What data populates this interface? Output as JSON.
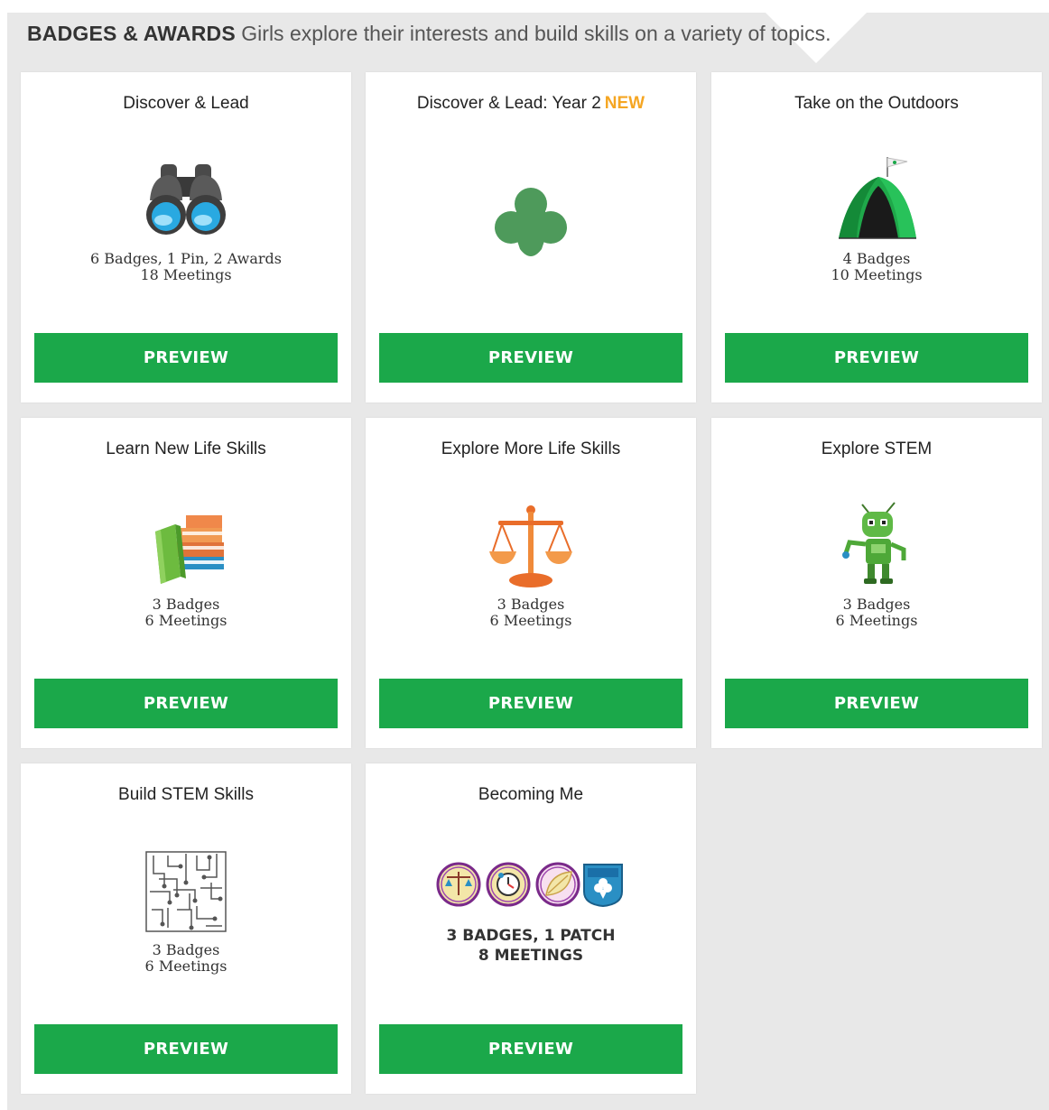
{
  "header": {
    "title": "BADGES & AWARDS",
    "tagline": "Girls explore their interests and build skills on a variety of topics."
  },
  "colors": {
    "button_green": "#1ba84a",
    "new_orange": "#f5a623",
    "panel_bg": "#e8e8e8"
  },
  "cards": [
    {
      "title": "Discover & Lead",
      "icon": "binoculars-icon",
      "meta_line1": "6 Badges, 1 Pin, 2 Awards",
      "meta_line2": "18 Meetings",
      "button": "PREVIEW"
    },
    {
      "title": "Discover & Lead: Year 2",
      "new_label": "NEW",
      "icon": "trefoil-icon",
      "button": "PREVIEW"
    },
    {
      "title": "Take on the Outdoors",
      "icon": "tent-icon",
      "meta_line1": "4 Badges",
      "meta_line2": "10 Meetings",
      "button": "PREVIEW"
    },
    {
      "title": "Learn New Life Skills",
      "icon": "books-icon",
      "meta_line1": "3 Badges",
      "meta_line2": "6 Meetings",
      "button": "PREVIEW"
    },
    {
      "title": "Explore More Life Skills",
      "icon": "scales-icon",
      "meta_line1": "3 Badges",
      "meta_line2": "6 Meetings",
      "button": "PREVIEW"
    },
    {
      "title": "Explore STEM",
      "icon": "robot-icon",
      "meta_line1": "3 Badges",
      "meta_line2": "6 Meetings",
      "button": "PREVIEW"
    },
    {
      "title": "Build STEM Skills",
      "icon": "circuit-icon",
      "meta_line1": "3 Badges",
      "meta_line2": "6 Meetings",
      "button": "PREVIEW"
    },
    {
      "title": "Becoming Me",
      "icon": "badge-set-icon",
      "meta_line1": "3 BADGES, 1 PATCH",
      "meta_line2": "8 MEETINGS",
      "button": "PREVIEW"
    }
  ]
}
